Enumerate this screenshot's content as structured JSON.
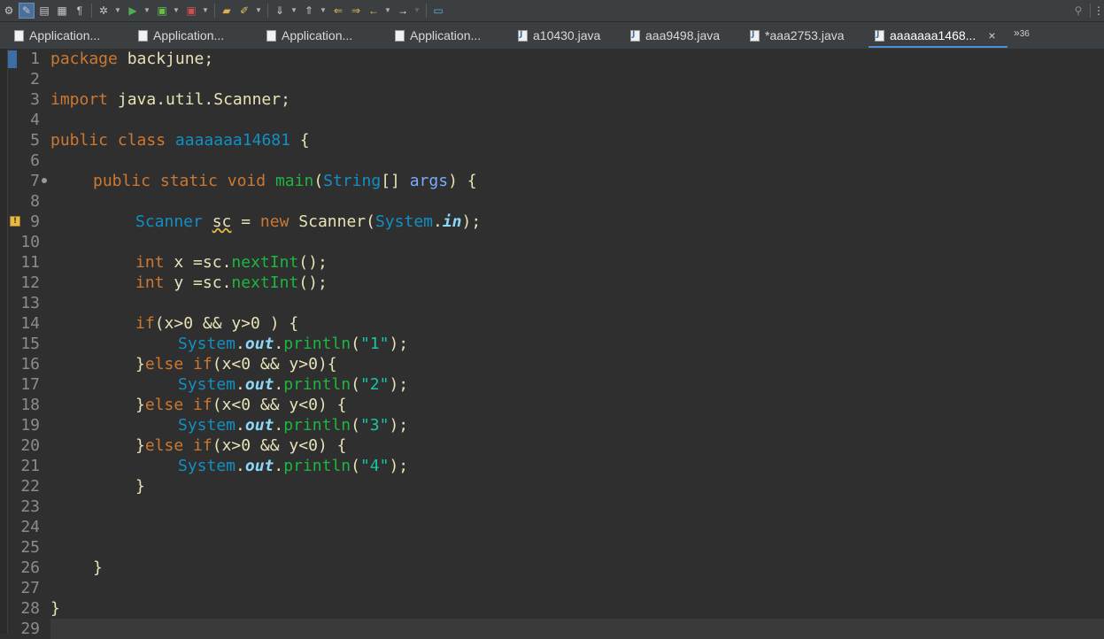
{
  "toolbar": {
    "icons": [
      "open-type-icon",
      "edit-icon",
      "new-file-icon",
      "save-icon",
      "paragraph-icon",
      "debug-icon",
      "run-icon",
      "coverage-icon",
      "external-tools-icon",
      "open-folder-icon",
      "highlight-icon",
      "annotation-icon",
      "sort-icon",
      "back-edit-icon",
      "forward-edit-icon",
      "back-icon",
      "forward-icon",
      "pin-icon",
      "search-icon",
      "perspective-icon"
    ]
  },
  "tabs": [
    {
      "label": "Application...",
      "type": "app"
    },
    {
      "label": "Application...",
      "type": "app"
    },
    {
      "label": "Application...",
      "type": "app"
    },
    {
      "label": "Application...",
      "type": "app"
    },
    {
      "label": "a10430.java",
      "type": "java"
    },
    {
      "label": "aaa9498.java",
      "type": "java"
    },
    {
      "label": "*aaa2753.java",
      "type": "java"
    },
    {
      "label": "aaaaaaa1468...",
      "type": "java",
      "active": true
    }
  ],
  "tab_close": "×",
  "overflow": {
    "chevron": "»",
    "count": "36"
  },
  "editor": {
    "line_numbers": [
      "1",
      "2",
      "3",
      "4",
      "5",
      "6",
      "7",
      "8",
      "9",
      "10",
      "11",
      "12",
      "13",
      "14",
      "15",
      "16",
      "17",
      "18",
      "19",
      "20",
      "21",
      "22",
      "23",
      "24",
      "25",
      "26",
      "27",
      "28",
      "29"
    ],
    "code": {
      "l1": {
        "kw": "package",
        "rest": " backjune;"
      },
      "l3": {
        "kw": "import",
        "rest": " java.util.Scanner;"
      },
      "l5": {
        "kw1": "public",
        "kw2": "class",
        "name": "aaaaaaa14681",
        "rest": " {"
      },
      "l7": {
        "kw1": "public",
        "kw2": "static",
        "kw3": "void",
        "mth": "main",
        "p1": "(",
        "type": "String",
        "p2": "[] ",
        "param": "args",
        "rest": ") {"
      },
      "l9": {
        "type": "Scanner",
        "var": "sc",
        "eq": " = ",
        "kw": "new",
        "ctor": "Scanner",
        "p1": "(",
        "sys": "System",
        "dot": ".",
        "fld": "in",
        "rest": ");"
      },
      "l11": {
        "kw": "int",
        "var": "x",
        "eq": " =",
        "obj": "sc",
        "dot": ".",
        "mth": "nextInt",
        "rest": "();"
      },
      "l12": {
        "kw": "int",
        "var": "y",
        "eq": " =",
        "obj": "sc",
        "dot": ".",
        "mth": "nextInt",
        "rest": "();"
      },
      "l14": {
        "kw": "if",
        "cond": "(x>0 && y>0 ) {"
      },
      "l15": {
        "sys": "System",
        "dot": ".",
        "fld": "out",
        "dot2": ".",
        "mth": "println",
        "p1": "(",
        "str": "\"1\"",
        "rest": ");"
      },
      "l16": {
        "brace": "}",
        "kw1": "else",
        "kw2": "if",
        "cond": "(x<0 && y>0){"
      },
      "l17": {
        "sys": "System",
        "dot": ".",
        "fld": "out",
        "dot2": ".",
        "mth": "println",
        "p1": "(",
        "str": "\"2\"",
        "rest": ");"
      },
      "l18": {
        "brace": "}",
        "kw1": "else",
        "kw2": "if",
        "cond": "(x<0 && y<0) {"
      },
      "l19": {
        "sys": "System",
        "dot": ".",
        "fld": "out",
        "dot2": ".",
        "mth": "println",
        "p1": "(",
        "str": "\"3\"",
        "rest": ");"
      },
      "l20": {
        "brace": "}",
        "kw1": "else",
        "kw2": "if",
        "cond": "(x>0 && y<0) {"
      },
      "l21": {
        "sys": "System",
        "dot": ".",
        "fld": "out",
        "dot2": ".",
        "mth": "println",
        "p1": "(",
        "str": "\"4\"",
        "rest": ");"
      },
      "l22": {
        "brace": "}"
      },
      "l26": {
        "brace": "}"
      },
      "l28": {
        "brace": "}"
      }
    }
  }
}
